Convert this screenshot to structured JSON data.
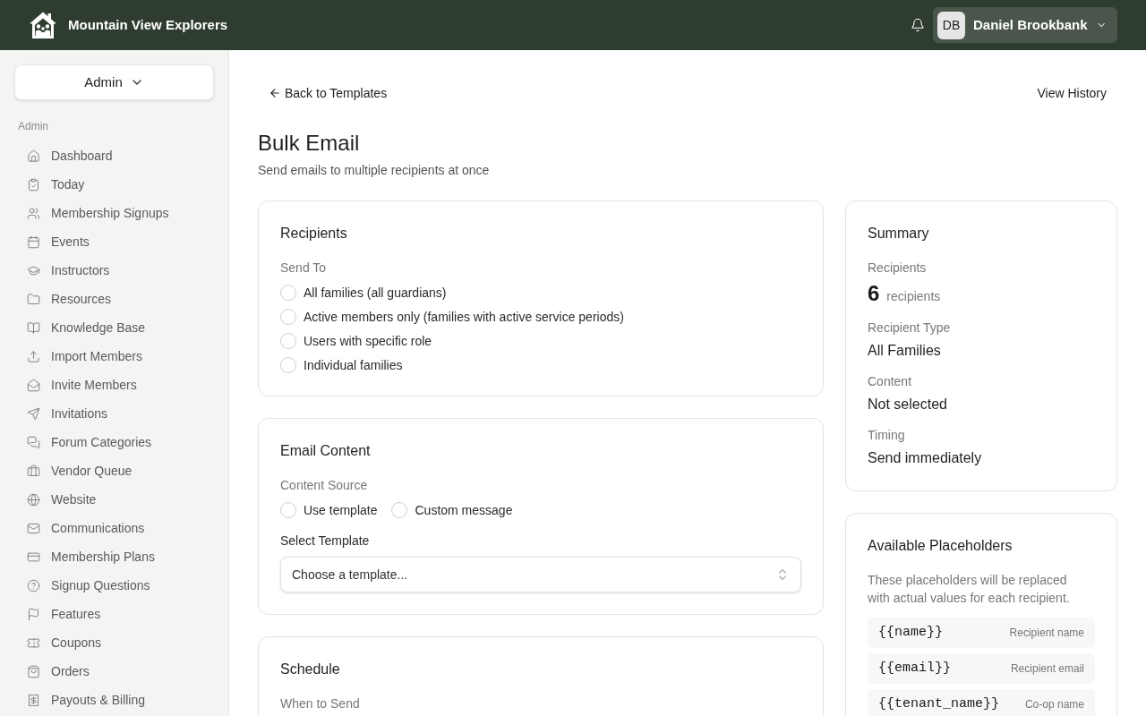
{
  "header": {
    "brand": "Mountain View Explorers",
    "user": {
      "initials": "DB",
      "name": "Daniel Brookbank"
    }
  },
  "sidebar": {
    "switcher": "Admin",
    "section_label": "Admin",
    "items": [
      "Dashboard",
      "Today",
      "Membership Signups",
      "Events",
      "Instructors",
      "Resources",
      "Knowledge Base",
      "Import Members",
      "Invite Members",
      "Invitations",
      "Forum Categories",
      "Vendor Queue",
      "Website",
      "Communications",
      "Membership Plans",
      "Signup Questions",
      "Features",
      "Coupons",
      "Orders",
      "Payouts & Billing"
    ]
  },
  "page": {
    "back_link": "Back to Templates",
    "history_link": "View History",
    "title": "Bulk Email",
    "subtitle": "Send emails to multiple recipients at once"
  },
  "recipients": {
    "title": "Recipients",
    "label": "Send To",
    "options": [
      {
        "label": "All families (all guardians)",
        "selected": false
      },
      {
        "label": "Active members only (families with active service periods)",
        "selected": false
      },
      {
        "label": "Users with specific role",
        "selected": false
      },
      {
        "label": "Individual families",
        "selected": false
      }
    ]
  },
  "email_content": {
    "title": "Email Content",
    "label": "Content Source",
    "options": [
      {
        "label": "Use template",
        "selected": false
      },
      {
        "label": "Custom message",
        "selected": false
      }
    ],
    "select_label": "Select Template",
    "select": {
      "placeholder": "Choose a template..."
    }
  },
  "schedule": {
    "title": "Schedule",
    "label": "When to Send"
  },
  "summary": {
    "title": "Summary",
    "fields": [
      {
        "kind": "count",
        "label": "Recipients",
        "value": "6",
        "unit": "recipients"
      },
      {
        "kind": "text",
        "label": "Recipient Type",
        "value": "All Families"
      },
      {
        "kind": "text",
        "label": "Content",
        "value": "Not selected"
      },
      {
        "kind": "text",
        "label": "Timing",
        "value": "Send immediately"
      }
    ]
  },
  "placeholders": {
    "title": "Available Placeholders",
    "description": "These placeholders will be replaced with actual values for each recipient.",
    "items": [
      {
        "token": "{{name}}",
        "description": "Recipient name"
      },
      {
        "token": "{{email}}",
        "description": "Recipient email"
      },
      {
        "token": "{{tenant_name}}",
        "description": "Co-op name"
      }
    ]
  }
}
